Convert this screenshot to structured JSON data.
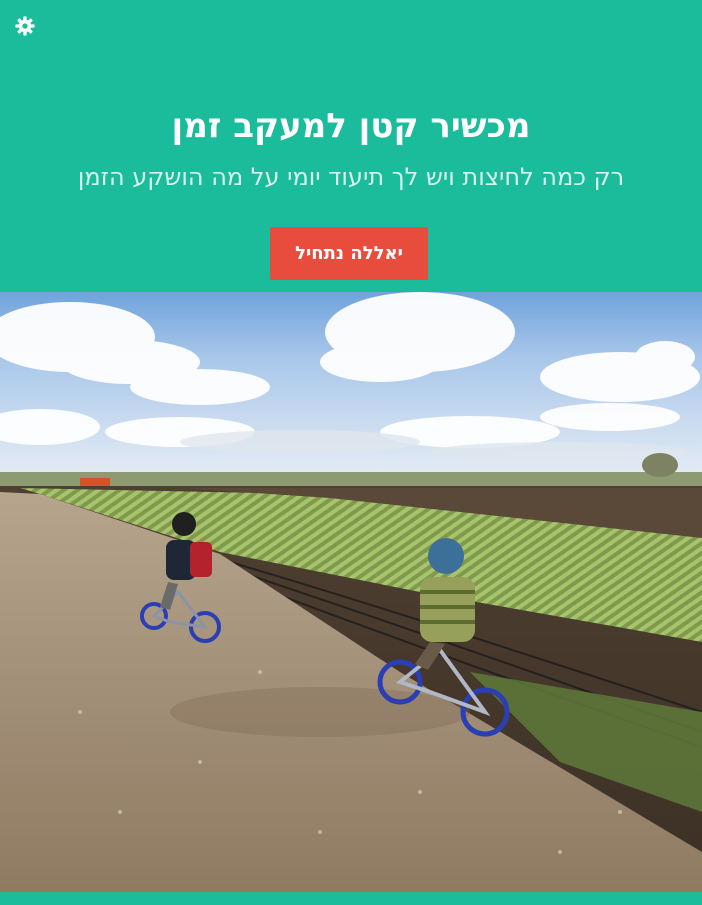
{
  "hero": {
    "title": "מכשיר קטן למעקב זמן",
    "subtitle": "רק כמה לחיצות ויש לך תיעוד יומי על מה הושקע הזמן",
    "cta_label": "יאללה נתחיל"
  },
  "icons": {
    "settings": "gear-icon"
  },
  "colors": {
    "brand": "#1abc9c",
    "cta": "#e74c3c",
    "title": "#ffffff",
    "subtitle": "#d8f3ec"
  }
}
